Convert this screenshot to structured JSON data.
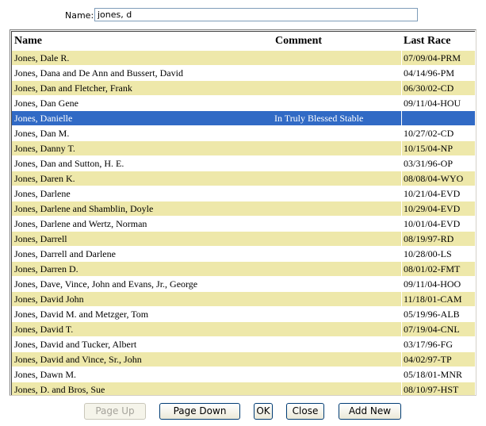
{
  "search": {
    "label": "Name:",
    "value": "jones, d"
  },
  "columns": {
    "name": "Name",
    "comment": "Comment",
    "last_race": "Last Race"
  },
  "rows": [
    {
      "name": "Jones, Dale R.",
      "comment": "",
      "last_race": "07/09/04-PRM"
    },
    {
      "name": "Jones, Dana and De Ann and Bussert, David",
      "comment": "",
      "last_race": "04/14/96-PM"
    },
    {
      "name": "Jones, Dan and Fletcher, Frank",
      "comment": "",
      "last_race": "06/30/02-CD"
    },
    {
      "name": "Jones, Dan Gene",
      "comment": "",
      "last_race": "09/11/04-HOU"
    },
    {
      "name": "Jones, Danielle",
      "comment": "In Truly Blessed Stable",
      "last_race": "",
      "selected": true
    },
    {
      "name": "Jones, Dan M.",
      "comment": "",
      "last_race": "10/27/02-CD"
    },
    {
      "name": "Jones, Danny T.",
      "comment": "",
      "last_race": "10/15/04-NP"
    },
    {
      "name": "Jones, Dan and Sutton, H. E.",
      "comment": "",
      "last_race": "03/31/96-OP"
    },
    {
      "name": "Jones, Daren K.",
      "comment": "",
      "last_race": "08/08/04-WYO"
    },
    {
      "name": "Jones, Darlene",
      "comment": "",
      "last_race": "10/21/04-EVD"
    },
    {
      "name": "Jones, Darlene and Shamblin, Doyle",
      "comment": "",
      "last_race": "10/29/04-EVD"
    },
    {
      "name": "Jones, Darlene and Wertz, Norman",
      "comment": "",
      "last_race": "10/01/04-EVD"
    },
    {
      "name": "Jones, Darrell",
      "comment": "",
      "last_race": "08/19/97-RD"
    },
    {
      "name": "Jones, Darrell and Darlene",
      "comment": "",
      "last_race": "10/28/00-LS"
    },
    {
      "name": "Jones, Darren D.",
      "comment": "",
      "last_race": "08/01/02-FMT"
    },
    {
      "name": "Jones, Dave, Vince, John and Evans, Jr., George",
      "comment": "",
      "last_race": "09/11/04-HOO"
    },
    {
      "name": "Jones, David John",
      "comment": "",
      "last_race": "11/18/01-CAM"
    },
    {
      "name": "Jones, David M. and Metzger, Tom",
      "comment": "",
      "last_race": "05/19/96-ALB"
    },
    {
      "name": "Jones, David T.",
      "comment": "",
      "last_race": "07/19/04-CNL"
    },
    {
      "name": "Jones, David and Tucker, Albert",
      "comment": "",
      "last_race": "03/17/96-FG"
    },
    {
      "name": "Jones, David and Vince, Sr., John",
      "comment": "",
      "last_race": "04/02/97-TP"
    },
    {
      "name": "Jones, Dawn M.",
      "comment": "",
      "last_race": "05/18/01-MNR"
    },
    {
      "name": "Jones, D. and Bros, Sue",
      "comment": "",
      "last_race": "08/10/97-HST"
    }
  ],
  "buttons": {
    "page_up": {
      "label": "Page Up",
      "enabled": false
    },
    "page_down": {
      "label": "Page Down",
      "enabled": true
    },
    "ok": {
      "label": "OK",
      "enabled": true
    },
    "close": {
      "label": "Close",
      "enabled": true
    },
    "add_new": {
      "label": "Add New",
      "enabled": true
    }
  },
  "colors": {
    "row_alt": "#eee8aa",
    "row_selected": "#316ac5",
    "row_selected_text": "#ffffff"
  }
}
